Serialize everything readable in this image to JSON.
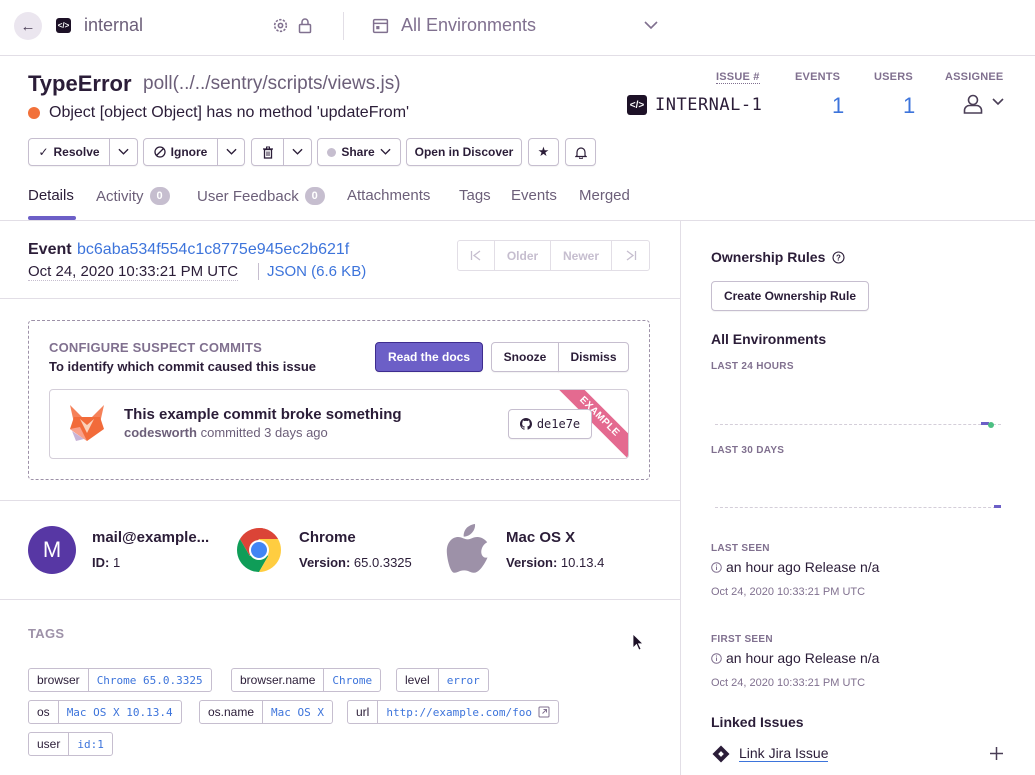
{
  "topbar": {
    "project": "internal",
    "environment": "All Environments"
  },
  "header": {
    "title": "TypeError",
    "culprit": "poll(../../sentry/scripts/views.js)",
    "message": "Object [object Object] has no method 'updateFrom'",
    "level_color": "#f2713a",
    "stats": {
      "issue_label": "ISSUE #",
      "events_label": "EVENTS",
      "users_label": "USERS",
      "assignee_label": "ASSIGNEE",
      "issue_id": "INTERNAL-1",
      "events": "1",
      "users": "1"
    }
  },
  "actions": {
    "resolve": "Resolve",
    "ignore": "Ignore",
    "share": "Share",
    "discover": "Open in Discover"
  },
  "tabs": [
    {
      "label": "Details"
    },
    {
      "label": "Activity",
      "badge": "0"
    },
    {
      "label": "User Feedback",
      "badge": "0"
    },
    {
      "label": "Attachments"
    },
    {
      "label": "Tags"
    },
    {
      "label": "Events"
    },
    {
      "label": "Merged"
    }
  ],
  "event": {
    "label": "Event",
    "id": "bc6aba534f554c1c8775e945ec2b621f",
    "date": "Oct 24, 2020 10:33:21 PM UTC",
    "json": "JSON (6.6 KB)",
    "older": "Older",
    "newer": "Newer"
  },
  "suspect": {
    "heading": "CONFIGURE SUSPECT COMMITS",
    "subheading": "To identify which commit caused this issue",
    "read_docs": "Read the docs",
    "snooze": "Snooze",
    "dismiss": "Dismiss",
    "commit_title": "This example commit broke something",
    "commit_author": "codesworth",
    "commit_text": "committed 3 days ago",
    "commit_sha": "de1e7e",
    "ribbon": "EXAMPLE"
  },
  "context": {
    "user": {
      "initial": "M",
      "title": "mail@example...",
      "label": "ID:",
      "value": "1"
    },
    "browser": {
      "title": "Chrome",
      "label": "Version:",
      "value": "65.0.3325"
    },
    "os": {
      "title": "Mac OS X",
      "label": "Version:",
      "value": "10.13.4"
    }
  },
  "tags": {
    "heading": "TAGS",
    "items": [
      {
        "key": "browser",
        "value": "Chrome 65.0.3325"
      },
      {
        "key": "browser.name",
        "value": "Chrome"
      },
      {
        "key": "level",
        "value": "error"
      },
      {
        "key": "os",
        "value": "Mac OS X 10.13.4"
      },
      {
        "key": "os.name",
        "value": "Mac OS X"
      },
      {
        "key": "url",
        "value": "http://example.com/foo"
      },
      {
        "key": "user",
        "value": "id:1"
      }
    ]
  },
  "sidebar": {
    "ownership": "Ownership Rules",
    "create_rule": "Create Ownership Rule",
    "env": "All Environments",
    "last24": "LAST 24 HOURS",
    "last30": "LAST 30 DAYS",
    "last_seen_label": "LAST SEEN",
    "last_seen": "an hour ago",
    "last_seen_release": "Release n/a",
    "last_seen_date": "Oct 24, 2020 10:33:21 PM UTC",
    "first_seen_label": "FIRST SEEN",
    "first_seen": "an hour ago",
    "first_seen_release": "Release n/a",
    "first_seen_date": "Oct 24, 2020 10:33:21 PM UTC",
    "linked_issues": "Linked Issues",
    "link_jira": "Link Jira Issue"
  }
}
